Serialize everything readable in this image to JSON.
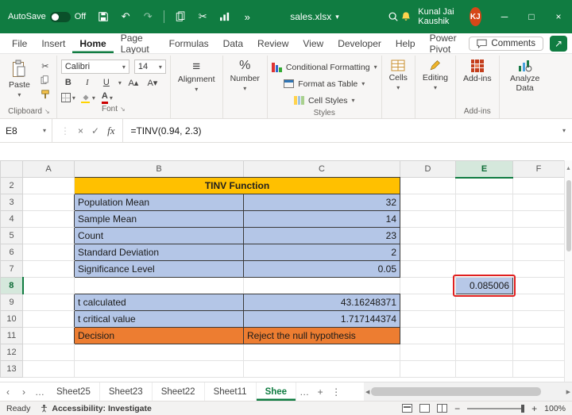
{
  "colors": {
    "excel_green": "#107C41",
    "header_yellow": "#FFC000",
    "cell_blue": "#B4C6E7",
    "decision_orange": "#ED7D31",
    "annotation_red": "#E02020",
    "avatar_orange": "#D64718"
  },
  "icons": {
    "dropdown": "▾",
    "undo": "↶",
    "redo": "↷",
    "scissors": "✂",
    "more_commands": "»",
    "cancel": "×",
    "enter": "✓",
    "fx": "fx",
    "dialog_launcher": "↘",
    "share_arrow": "↗",
    "chevron_left": "‹",
    "chevron_right": "›",
    "ellipsis": "…",
    "more_vertical": "⋮",
    "add_sheet": "+",
    "minimize": "─",
    "maximize": "□",
    "close": "×",
    "scroll_left": "◀",
    "scroll_right": "▶",
    "scroll_up": "▲",
    "alignment_lines": "≡",
    "percent": "%",
    "zoom_out": "−",
    "zoom_in": "+",
    "font_grow": "A▴",
    "font_shrink": "A▾"
  },
  "titlebar": {
    "autosave_label": "AutoSave",
    "autosave_state": "Off",
    "filename": "sales.xlsx",
    "user_name": "Kunal Jai Kaushik",
    "user_initials": "KJ"
  },
  "menu": {
    "tabs": [
      {
        "label": "File"
      },
      {
        "label": "Insert"
      },
      {
        "label": "Home"
      },
      {
        "label": "Page Layout"
      },
      {
        "label": "Formulas"
      },
      {
        "label": "Data"
      },
      {
        "label": "Review"
      },
      {
        "label": "View"
      },
      {
        "label": "Developer"
      },
      {
        "label": "Help"
      },
      {
        "label": "Power Pivot"
      }
    ],
    "active_tab": "Home",
    "comments_label": "Comments"
  },
  "ribbon": {
    "paste_label": "Paste",
    "clipboard_group_label": "Clipboard",
    "font_name": "Calibri",
    "font_size": "14",
    "bold": "B",
    "italic": "I",
    "underline": "U",
    "font_group_label": "Font",
    "alignment_label": "Alignment",
    "number_label": "Number",
    "conditional_formatting_label": "Conditional Formatting",
    "format_as_table_label": "Format as Table",
    "cell_styles_label": "Cell Styles",
    "styles_group_label": "Styles",
    "cells_label": "Cells",
    "editing_label": "Editing",
    "addins_label": "Add-ins",
    "addins_group_label": "Add-ins",
    "analyze_data_label": "Analyze Data"
  },
  "formula_bar": {
    "name_box": "E8",
    "formula": "=TINV(0.94, 2.3)"
  },
  "grid": {
    "columns": [
      "A",
      "B",
      "C",
      "D",
      "E",
      "F"
    ],
    "rows": [
      "2",
      "3",
      "4",
      "5",
      "6",
      "7",
      "8",
      "9",
      "10",
      "11",
      "12",
      "13"
    ],
    "selected_column": "E",
    "selected_row": "8",
    "table_title": "TINV Function",
    "data_rows": [
      {
        "label": "Population Mean",
        "value": "32"
      },
      {
        "label": "Sample Mean",
        "value": "14"
      },
      {
        "label": "Count",
        "value": "23"
      },
      {
        "label": "Standard Deviation",
        "value": "2"
      },
      {
        "label": "Significance Level",
        "value": "0.05"
      }
    ],
    "result_cell": {
      "ref": "E8",
      "value": "0.085006"
    },
    "calc_rows": [
      {
        "label": "t calculated",
        "value": "43.16248371"
      },
      {
        "label": "t critical value",
        "value": "1.717144374"
      }
    ],
    "decision_row": {
      "label": "Decision",
      "value": "Reject the null hypothesis"
    }
  },
  "sheet_tabs": {
    "tabs": [
      {
        "label": "Sheet25"
      },
      {
        "label": "Sheet23"
      },
      {
        "label": "Sheet22"
      },
      {
        "label": "Sheet11"
      },
      {
        "label": "Shee"
      }
    ],
    "active_tab": "Shee"
  },
  "status_bar": {
    "ready_label": "Ready",
    "accessibility_label": "Accessibility: Investigate",
    "zoom_level": "100%"
  }
}
